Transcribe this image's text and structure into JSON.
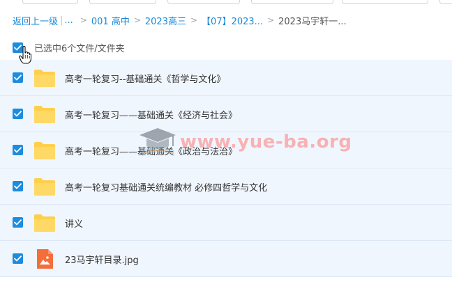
{
  "breadcrumb": {
    "back_label": "返回上一级",
    "ellipsis": "...",
    "separator": ">",
    "items": [
      {
        "label": "001 高中"
      },
      {
        "label": "2023高三"
      },
      {
        "label": "【07】2023..."
      }
    ],
    "current": "2023马宇轩一..."
  },
  "selection": {
    "summary": "已选中6个文件/文件夹",
    "all_checked": true
  },
  "files": [
    {
      "name": "高考一轮复习--基础通关《哲学与文化》",
      "type": "folder",
      "checked": true
    },
    {
      "name": "高考一轮复习——基础通关《经济与社会》",
      "type": "folder",
      "checked": true
    },
    {
      "name": "高考一轮复习——基础通关《政治与法治》",
      "type": "folder",
      "checked": true
    },
    {
      "name": "高考一轮复习基础通关统编教材 必修四哲学与文化",
      "type": "folder",
      "checked": true
    },
    {
      "name": "讲义",
      "type": "folder",
      "checked": true
    },
    {
      "name": "23马宇轩目录.jpg",
      "type": "image",
      "checked": true
    }
  ],
  "watermark": {
    "text": "www.yue-ba.org"
  },
  "colors": {
    "accent": "#1c8cde",
    "link": "#1a8ad8",
    "row_selected": "#f0f6fd",
    "folder": "#ffcf4b",
    "image_file": "#f46e3c"
  },
  "icons": {
    "folder": "folder-icon",
    "image": "image-file-icon",
    "checkbox": "checkmark-icon",
    "cursor": "hand-pointer-icon"
  }
}
